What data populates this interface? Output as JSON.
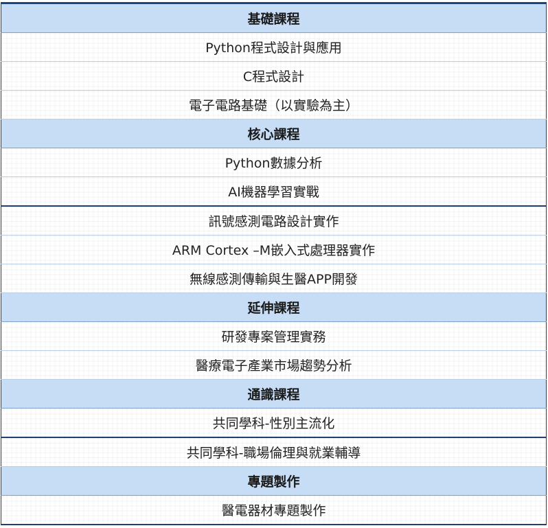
{
  "sections": [
    {
      "title": "基礎課程",
      "courses": [
        "Python程式設計與應用",
        "C程式設計",
        "電子電路基礎（以實驗為主）"
      ]
    },
    {
      "title": "核心課程",
      "courses": [
        "Python數據分析",
        "AI機器學習實戰",
        "訊號感測電路設計實作",
        "ARM Cortex –M嵌入式處理器實作",
        "無線感測傳輸與生醫APP開發"
      ]
    },
    {
      "title": "延伸課程",
      "courses": [
        "研發專案管理實務",
        "醫療電子產業市場趨勢分析"
      ]
    },
    {
      "title": "通識課程",
      "courses": [
        "共同學科-性別主流化",
        "共同學科-職場倫理與就業輔導"
      ]
    },
    {
      "title": "專題製作",
      "courses": [
        "醫電器材專題製作"
      ]
    }
  ]
}
